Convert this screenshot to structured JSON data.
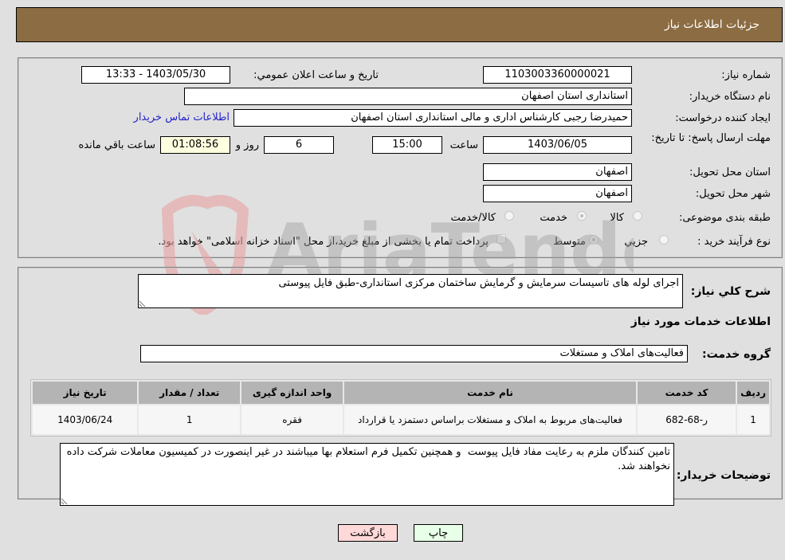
{
  "header": {
    "title": "جزئیات اطلاعات نیاز"
  },
  "form": {
    "need_number": {
      "label": "شماره نیاز:",
      "value": "1103003360000021"
    },
    "announce_datetime": {
      "label": "تاریخ و ساعت اعلان عمومي:",
      "value": "1403/05/30 - 13:33"
    },
    "buyer_org": {
      "label": "نام دستگاه خریدار:",
      "value": "استانداری استان اصفهان"
    },
    "creator": {
      "label": "ایجاد کننده درخواست:",
      "value": "حمیدرضا رجبی کارشناس اداری و مالی استانداری استان اصفهان"
    },
    "contact_link": "اطلاعات تماس خریدار",
    "deadline": {
      "label": "مهلت ارسال پاسخ: تا تاریخ:",
      "date": "1403/06/05",
      "time_label": "ساعت",
      "time": "15:00",
      "days": "6",
      "days_label": "روز و",
      "remaining": "01:08:56",
      "remaining_label": "ساعت باقي مانده"
    },
    "province": {
      "label": "استان محل تحویل:",
      "value": "اصفهان"
    },
    "city": {
      "label": "شهر محل تحویل:",
      "value": "اصفهان"
    },
    "category": {
      "label": "طبقه بندی موضوعی:",
      "options": [
        "کالا",
        "خدمت",
        "کالا/خدمت"
      ],
      "selected": "خدمت"
    },
    "purchase_type": {
      "label": "نوع فرآیند خرید :",
      "options": [
        "جزيي",
        "متوسط"
      ],
      "selected": "متوسط",
      "treasury_note": "پرداخت تمام یا بخشی از مبلغ خرید،از محل \"اسناد خزانه اسلامی\" خواهد بود."
    }
  },
  "details": {
    "description_label": "شرح کلي نیاز:",
    "description": "اجرای لوله های تاسیسات سرمایش و گرمایش ساختمان مرکزی استانداری-طبق فایل پیوستی",
    "services_heading": "اطلاعات خدمات مورد نیاز",
    "service_group_label": "گروه خدمت:",
    "service_group": "فعالیت‌های  املاک و مستغلات",
    "table": {
      "headers": [
        "ردیف",
        "کد خدمت",
        "نام خدمت",
        "واحد اندازه گیری",
        "تعداد / مقدار",
        "تاریخ نیاز"
      ],
      "rows": [
        [
          "1",
          "ر-68-682",
          "فعالیت‌های مربوط به املاک و مستغلات براساس دستمزد یا قرارداد",
          "فقره",
          "1",
          "1403/06/24"
        ]
      ]
    },
    "buyer_notes_label": "توضیحات خریدار:",
    "buyer_notes": "تامین کنندگان ملزم به رعایت مفاد فایل پیوست  و همچنین تکمیل فرم استعلام بها میباشند در غیر اینصورت در کمیسیون معاملات شرکت داده نخواهند شد."
  },
  "buttons": {
    "print": "چاپ",
    "back": "بازگشت"
  },
  "watermark": {
    "text": "AriaTender.neT"
  },
  "colors": {
    "header_bg": "#8c6c42",
    "page_bg": "#e0e0e0",
    "link": "#2222cc",
    "back_btn": "#ffd8d8",
    "print_btn": "#e8ffe8",
    "remaining_bg": "#ffffe0"
  }
}
